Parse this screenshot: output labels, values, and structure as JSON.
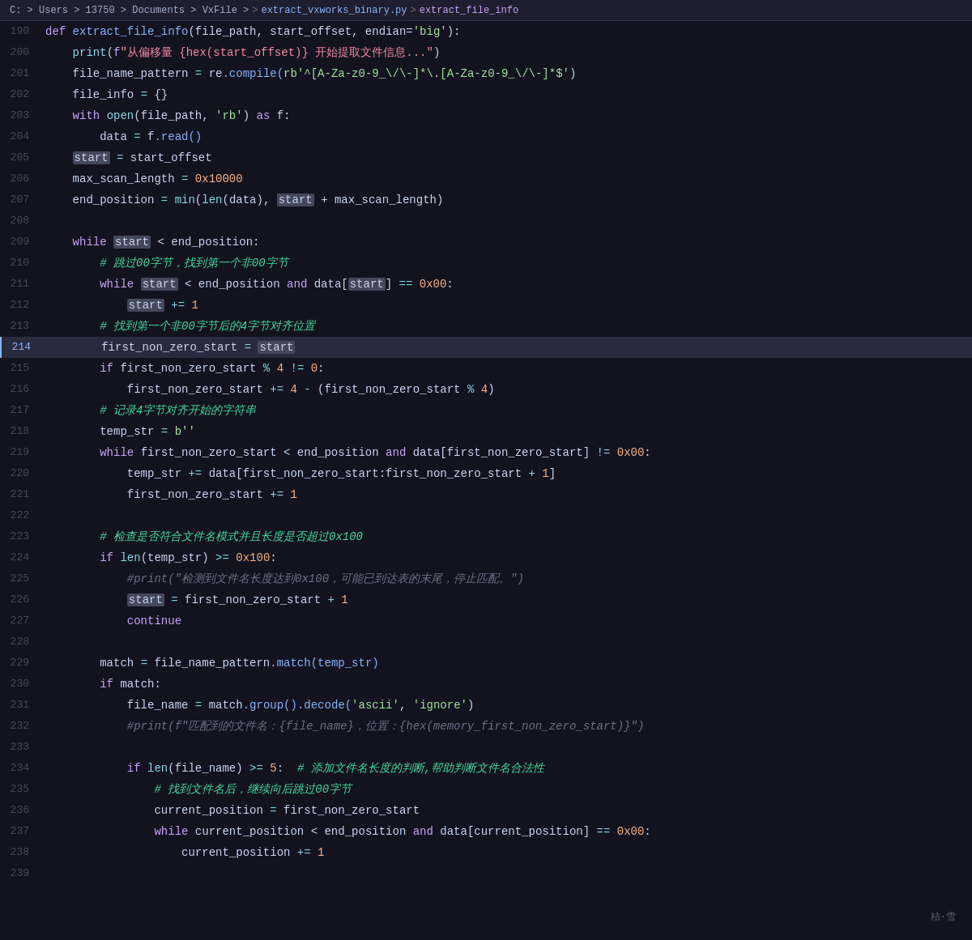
{
  "breadcrumb": {
    "path": "C: > Users > 13750 > Documents > VxFile > ",
    "file": "extract_vxworks_binary.py",
    "sep1": " > ",
    "func": "extract_file_info"
  },
  "lines": [
    {
      "num": 190,
      "tokens": [
        {
          "t": "def ",
          "c": "kw"
        },
        {
          "t": "extract_file_info",
          "c": "fn"
        },
        {
          "t": "(file_path, start_offset, endian=",
          "c": "var"
        },
        {
          "t": "'big'",
          "c": "str"
        },
        {
          "t": "):",
          "c": "var"
        }
      ]
    },
    {
      "num": 200,
      "tokens": [
        {
          "t": "    print",
          "c": "kw2"
        },
        {
          "t": "(",
          "c": "punct"
        },
        {
          "t": "f",
          "c": "kw"
        },
        {
          "t": "\"从偏移量 {hex(start_offset)} 开始提取文件信息...\"",
          "c": "str2"
        },
        {
          "t": ")",
          "c": "punct"
        }
      ]
    },
    {
      "num": 201,
      "tokens": [
        {
          "t": "    file_name_pattern ",
          "c": "var"
        },
        {
          "t": "= ",
          "c": "op"
        },
        {
          "t": "re",
          "c": "var"
        },
        {
          "t": ".compile(",
          "c": "method"
        },
        {
          "t": "rb'^[A-Za-z0-9_\\/\\-]*\\.[A-Za-z0-9_\\/\\-]*$'",
          "c": "re-str"
        },
        {
          "t": ")",
          "c": "punct"
        }
      ]
    },
    {
      "num": 202,
      "tokens": [
        {
          "t": "    file_info ",
          "c": "var"
        },
        {
          "t": "= ",
          "c": "op"
        },
        {
          "t": "{}",
          "c": "punct"
        }
      ]
    },
    {
      "num": 203,
      "tokens": [
        {
          "t": "    with ",
          "c": "kw"
        },
        {
          "t": "open",
          "c": "kw2"
        },
        {
          "t": "(file_path, ",
          "c": "var"
        },
        {
          "t": "'rb'",
          "c": "str"
        },
        {
          "t": ") ",
          "c": "punct"
        },
        {
          "t": "as ",
          "c": "kw"
        },
        {
          "t": "f:",
          "c": "var"
        }
      ]
    },
    {
      "num": 204,
      "tokens": [
        {
          "t": "        data ",
          "c": "var"
        },
        {
          "t": "= ",
          "c": "op"
        },
        {
          "t": "f",
          "c": "var"
        },
        {
          "t": ".read()",
          "c": "method"
        }
      ]
    },
    {
      "num": 205,
      "tokens": [
        {
          "t": "    ",
          "c": "var"
        },
        {
          "t": "start",
          "c": "var-highlight"
        },
        {
          "t": " ",
          "c": "var"
        },
        {
          "t": "= ",
          "c": "op"
        },
        {
          "t": "start_offset",
          "c": "var"
        }
      ]
    },
    {
      "num": 206,
      "tokens": [
        {
          "t": "    max_scan_length ",
          "c": "var"
        },
        {
          "t": "= ",
          "c": "op"
        },
        {
          "t": "0x10000",
          "c": "num"
        }
      ]
    },
    {
      "num": 207,
      "tokens": [
        {
          "t": "    end_position ",
          "c": "var"
        },
        {
          "t": "= ",
          "c": "op"
        },
        {
          "t": "min",
          "c": "kw2"
        },
        {
          "t": "(",
          "c": "punct"
        },
        {
          "t": "len",
          "c": "kw2"
        },
        {
          "t": "(data), ",
          "c": "var"
        },
        {
          "t": "start",
          "c": "var-highlight"
        },
        {
          "t": " ",
          "c": "var"
        },
        {
          "t": "+ max_scan_length)",
          "c": "var"
        }
      ]
    },
    {
      "num": 208,
      "tokens": []
    },
    {
      "num": 209,
      "tokens": [
        {
          "t": "    while ",
          "c": "kw"
        },
        {
          "t": "start",
          "c": "var-highlight"
        },
        {
          "t": " ",
          "c": "var"
        },
        {
          "t": "< end_position:",
          "c": "var"
        }
      ]
    },
    {
      "num": 210,
      "tokens": [
        {
          "t": "        # 跳过00字节，找到第一个非00字节",
          "c": "comment-zh"
        }
      ]
    },
    {
      "num": 211,
      "tokens": [
        {
          "t": "        while ",
          "c": "kw"
        },
        {
          "t": "start",
          "c": "var-highlight"
        },
        {
          "t": " ",
          "c": "var"
        },
        {
          "t": "< end_position ",
          "c": "var"
        },
        {
          "t": "and ",
          "c": "kw"
        },
        {
          "t": "data[",
          "c": "var"
        },
        {
          "t": "start",
          "c": "var-highlight"
        },
        {
          "t": "] ",
          "c": "var"
        },
        {
          "t": "== ",
          "c": "op"
        },
        {
          "t": "0x00",
          "c": "num"
        },
        {
          "t": ":",
          "c": "punct"
        }
      ]
    },
    {
      "num": 212,
      "tokens": [
        {
          "t": "            ",
          "c": "var"
        },
        {
          "t": "start",
          "c": "var-highlight"
        },
        {
          "t": " ",
          "c": "var"
        },
        {
          "t": "+=",
          "c": "op"
        },
        {
          "t": " 1",
          "c": "num"
        }
      ]
    },
    {
      "num": 213,
      "tokens": [
        {
          "t": "        # 找到第一个非00字节后的4字节对齐位置",
          "c": "comment-zh"
        }
      ]
    },
    {
      "num": 214,
      "tokens": [
        {
          "t": "        first_non_zero_start ",
          "c": "var"
        },
        {
          "t": "= ",
          "c": "op"
        },
        {
          "t": "start",
          "c": "var-highlight"
        }
      ],
      "highlight": true
    },
    {
      "num": 215,
      "tokens": [
        {
          "t": "        if ",
          "c": "kw"
        },
        {
          "t": "first_non_zero_start ",
          "c": "var"
        },
        {
          "t": "% ",
          "c": "op"
        },
        {
          "t": "4 ",
          "c": "num"
        },
        {
          "t": "!= ",
          "c": "op"
        },
        {
          "t": "0",
          "c": "num"
        },
        {
          "t": ":",
          "c": "punct"
        }
      ]
    },
    {
      "num": 216,
      "tokens": [
        {
          "t": "            first_non_zero_start ",
          "c": "var"
        },
        {
          "t": "+=",
          "c": "op"
        },
        {
          "t": " 4 ",
          "c": "num"
        },
        {
          "t": "- ",
          "c": "op"
        },
        {
          "t": "(first_non_zero_start ",
          "c": "var"
        },
        {
          "t": "% ",
          "c": "op"
        },
        {
          "t": "4",
          "c": "num"
        },
        {
          "t": ")",
          "c": "punct"
        }
      ]
    },
    {
      "num": 217,
      "tokens": [
        {
          "t": "        # 记录4字节对齐开始的字符串",
          "c": "comment-zh"
        }
      ]
    },
    {
      "num": 218,
      "tokens": [
        {
          "t": "        temp_str ",
          "c": "var"
        },
        {
          "t": "= ",
          "c": "op"
        },
        {
          "t": "b''",
          "c": "str"
        }
      ]
    },
    {
      "num": 219,
      "tokens": [
        {
          "t": "        while ",
          "c": "kw"
        },
        {
          "t": "first_non_zero_start < end_position ",
          "c": "var"
        },
        {
          "t": "and ",
          "c": "kw"
        },
        {
          "t": "data[first_non_zero_start] ",
          "c": "var"
        },
        {
          "t": "!= ",
          "c": "op"
        },
        {
          "t": "0x00",
          "c": "num"
        },
        {
          "t": ":",
          "c": "punct"
        }
      ]
    },
    {
      "num": 220,
      "tokens": [
        {
          "t": "            temp_str ",
          "c": "var"
        },
        {
          "t": "+=",
          "c": "op"
        },
        {
          "t": " data[first_non_zero_start:first_non_zero_start ",
          "c": "var"
        },
        {
          "t": "+ ",
          "c": "op"
        },
        {
          "t": "1",
          "c": "num"
        },
        {
          "t": "]",
          "c": "punct"
        }
      ]
    },
    {
      "num": 221,
      "tokens": [
        {
          "t": "            first_non_zero_start ",
          "c": "var"
        },
        {
          "t": "+=",
          "c": "op"
        },
        {
          "t": " 1",
          "c": "num"
        }
      ]
    },
    {
      "num": 222,
      "tokens": []
    },
    {
      "num": 223,
      "tokens": [
        {
          "t": "        # 检查是否符合文件名模式并且长度是否超过0x100",
          "c": "comment-zh"
        }
      ]
    },
    {
      "num": 224,
      "tokens": [
        {
          "t": "        if ",
          "c": "kw"
        },
        {
          "t": "len",
          "c": "kw2"
        },
        {
          "t": "(temp_str) ",
          "c": "var"
        },
        {
          "t": ">= ",
          "c": "op"
        },
        {
          "t": "0x100",
          "c": "num"
        },
        {
          "t": ":",
          "c": "punct"
        }
      ]
    },
    {
      "num": 225,
      "tokens": [
        {
          "t": "            #print(\"检测到文件名长度达到0x100，可能已到达表的末尾，停止匹配。\")",
          "c": "comment"
        }
      ]
    },
    {
      "num": 226,
      "tokens": [
        {
          "t": "            ",
          "c": "var"
        },
        {
          "t": "start",
          "c": "var-highlight"
        },
        {
          "t": " ",
          "c": "var"
        },
        {
          "t": "= ",
          "c": "op"
        },
        {
          "t": "first_non_zero_start ",
          "c": "var"
        },
        {
          "t": "+ ",
          "c": "op"
        },
        {
          "t": "1",
          "c": "num"
        }
      ]
    },
    {
      "num": 227,
      "tokens": [
        {
          "t": "            continue",
          "c": "kw"
        }
      ]
    },
    {
      "num": 228,
      "tokens": []
    },
    {
      "num": 229,
      "tokens": [
        {
          "t": "        match ",
          "c": "var"
        },
        {
          "t": "= ",
          "c": "op"
        },
        {
          "t": "file_name_pattern",
          "c": "var"
        },
        {
          "t": ".match(temp_str)",
          "c": "method"
        }
      ]
    },
    {
      "num": 230,
      "tokens": [
        {
          "t": "        if ",
          "c": "kw"
        },
        {
          "t": "match",
          "c": "var"
        },
        {
          "t": ":",
          "c": "punct"
        }
      ]
    },
    {
      "num": 231,
      "tokens": [
        {
          "t": "            file_name ",
          "c": "var"
        },
        {
          "t": "= ",
          "c": "op"
        },
        {
          "t": "match",
          "c": "var"
        },
        {
          "t": ".group()",
          "c": "method"
        },
        {
          "t": ".decode(",
          "c": "method"
        },
        {
          "t": "'ascii'",
          "c": "str"
        },
        {
          "t": ", ",
          "c": "punct"
        },
        {
          "t": "'ignore'",
          "c": "str"
        },
        {
          "t": ")",
          "c": "punct"
        }
      ]
    },
    {
      "num": 232,
      "tokens": [
        {
          "t": "            #print(f\"匹配到的文件名：{file_name}，位置：{hex(memory_first_non_zero_start)}\")",
          "c": "comment"
        }
      ]
    },
    {
      "num": 233,
      "tokens": []
    },
    {
      "num": 234,
      "tokens": [
        {
          "t": "            if ",
          "c": "kw"
        },
        {
          "t": "len",
          "c": "kw2"
        },
        {
          "t": "(file_name) ",
          "c": "var"
        },
        {
          "t": ">= ",
          "c": "op"
        },
        {
          "t": "5",
          "c": "num"
        },
        {
          "t": ":  ",
          "c": "punct"
        },
        {
          "t": "# 添加文件名长度的判断,帮助判断文件名合法性",
          "c": "comment-zh"
        }
      ]
    },
    {
      "num": 235,
      "tokens": [
        {
          "t": "                # 找到文件名后，继续向后跳过00字节",
          "c": "comment-zh"
        }
      ]
    },
    {
      "num": 236,
      "tokens": [
        {
          "t": "                current_position ",
          "c": "var"
        },
        {
          "t": "= ",
          "c": "op"
        },
        {
          "t": "first_non_zero_start",
          "c": "var"
        }
      ]
    },
    {
      "num": 237,
      "tokens": [
        {
          "t": "                while ",
          "c": "kw"
        },
        {
          "t": "current_position < end_position ",
          "c": "var"
        },
        {
          "t": "and ",
          "c": "kw"
        },
        {
          "t": "data[current_position] ",
          "c": "var"
        },
        {
          "t": "== ",
          "c": "op"
        },
        {
          "t": "0x00",
          "c": "num"
        },
        {
          "t": ":",
          "c": "punct"
        }
      ]
    },
    {
      "num": 238,
      "tokens": [
        {
          "t": "                    current_position ",
          "c": "var"
        },
        {
          "t": "+=",
          "c": "op"
        },
        {
          "t": " 1",
          "c": "num"
        }
      ]
    },
    {
      "num": 239,
      "tokens": []
    }
  ]
}
